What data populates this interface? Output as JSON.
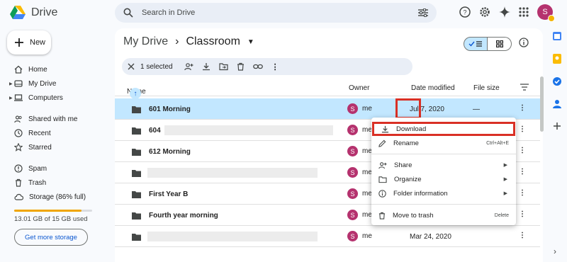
{
  "app": {
    "name": "Drive",
    "avatar_letter": "S"
  },
  "search": {
    "placeholder": "Search in Drive"
  },
  "sidebar": {
    "new_label": "New",
    "items": [
      {
        "label": "Home",
        "icon": "home-icon"
      },
      {
        "label": "My Drive",
        "icon": "drive-icon"
      },
      {
        "label": "Computers",
        "icon": "computer-icon"
      },
      {
        "label": "Shared with me",
        "icon": "people-icon"
      },
      {
        "label": "Recent",
        "icon": "clock-icon"
      },
      {
        "label": "Starred",
        "icon": "star-icon"
      },
      {
        "label": "Spam",
        "icon": "spam-icon"
      },
      {
        "label": "Trash",
        "icon": "trash-icon"
      },
      {
        "label": "Storage (86% full)",
        "icon": "cloud-icon"
      }
    ],
    "storage_percent": 86,
    "storage_used": "13.01 GB of 15 GB used",
    "get_storage_label": "Get more storage"
  },
  "breadcrumb": {
    "root": "My Drive",
    "current": "Classroom"
  },
  "selection": {
    "count_label": "1 selected"
  },
  "columns": {
    "name": "Name",
    "owner": "Owner",
    "date": "Date modified",
    "size": "File size"
  },
  "rows": [
    {
      "name": "601 Morning",
      "owner": "me",
      "date": "Jul 7, 2020",
      "size": "—"
    },
    {
      "name": "604",
      "owner": "me",
      "date": "",
      "size": ""
    },
    {
      "name": "612 Morning",
      "owner": "me",
      "date": "",
      "size": ""
    },
    {
      "name": "",
      "owner": "me",
      "date": "",
      "size": ""
    },
    {
      "name": "First Year B",
      "owner": "me",
      "date": "",
      "size": ""
    },
    {
      "name": "Fourth year morning",
      "owner": "me",
      "date": "",
      "size": ""
    },
    {
      "name": "",
      "owner": "me",
      "date": "Mar 24, 2020",
      "size": ""
    }
  ],
  "context_menu": {
    "download": "Download",
    "rename": "Rename",
    "rename_shortcut": "Ctrl+Alt+E",
    "share": "Share",
    "organize": "Organize",
    "folder_info": "Folder information",
    "move_to_trash": "Move to trash",
    "delete_shortcut": "Delete"
  },
  "colors": {
    "selected_row": "#c2e7ff",
    "highlight_border": "#d93025",
    "avatar": "#b5326e",
    "storage_fill": "#f0a500"
  }
}
